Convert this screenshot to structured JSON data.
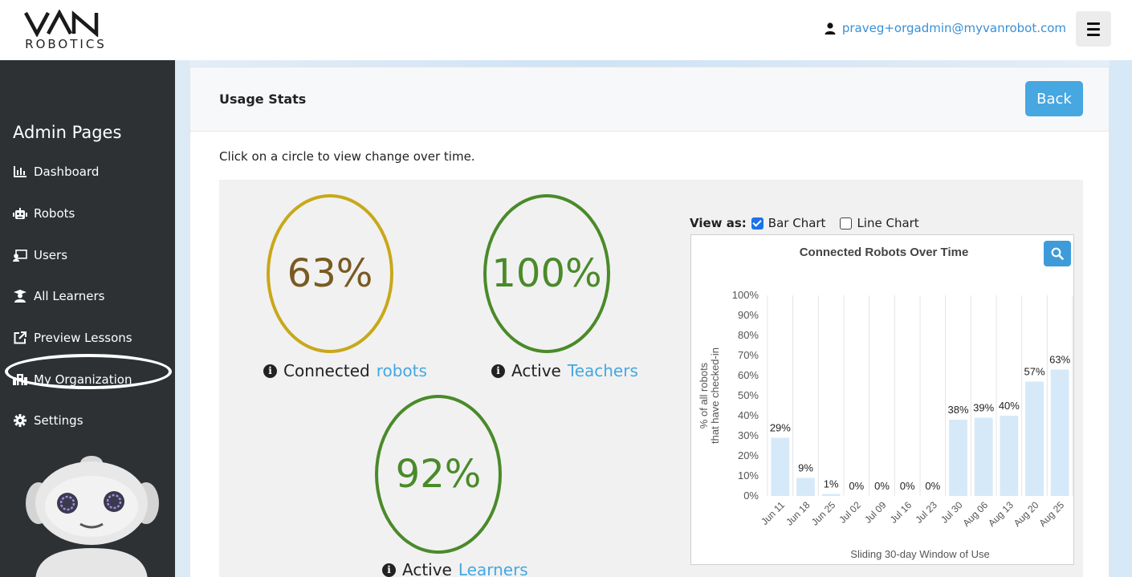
{
  "header": {
    "logo_text": "ROBOTICS",
    "user_email": "praveg+orgadmin@myvanrobot.com"
  },
  "sidebar": {
    "title": "Admin Pages",
    "items": [
      {
        "label": "Dashboard",
        "icon": "chart-icon"
      },
      {
        "label": "Robots",
        "icon": "robot-icon"
      },
      {
        "label": "Users",
        "icon": "users-icon"
      },
      {
        "label": "All Learners",
        "icon": "learner-icon"
      },
      {
        "label": "Preview Lessons",
        "icon": "external-link-icon"
      },
      {
        "label": "My Organization",
        "icon": "organization-icon"
      },
      {
        "label": "Settings",
        "icon": "gear-icon"
      }
    ]
  },
  "card": {
    "title": "Usage Stats",
    "back_label": "Back",
    "instruction": "Click on a circle to view change over time."
  },
  "stats": [
    {
      "value": "63%",
      "label_prefix": "Connected",
      "label_link": "robots",
      "color": "#c8a81a",
      "text_color": "#7a5a22"
    },
    {
      "value": "100%",
      "label_prefix": "Active",
      "label_link": "Teachers",
      "color": "#4a8a2a",
      "text_color": "#4a8a2a"
    },
    {
      "value": "92%",
      "label_prefix": "Active",
      "label_link": "Learners",
      "color": "#4a8a2a",
      "text_color": "#4a8a2a"
    }
  ],
  "view_as": {
    "label": "View as:",
    "bar_label": "Bar Chart",
    "line_label": "Line Chart",
    "bar_checked": true,
    "line_checked": false
  },
  "chart_data": {
    "type": "bar",
    "title": "Connected Robots Over Time",
    "xlabel": "Sliding 30-day Window of Use",
    "ylabel_line1": "% of all robots",
    "ylabel_line2": "that have checked-in",
    "categories": [
      "Jun 11",
      "Jun 18",
      "Jun 25",
      "Jul 02",
      "Jul 09",
      "Jul 16",
      "Jul 23",
      "Jul 30",
      "Aug 06",
      "Aug 13",
      "Aug 20",
      "Aug 25"
    ],
    "values": [
      29,
      9,
      1,
      0,
      0,
      0,
      0,
      38,
      39,
      40,
      57,
      63
    ],
    "ylim": [
      0,
      100
    ],
    "yticks": [
      "0%",
      "10%",
      "20%",
      "30%",
      "40%",
      "50%",
      "60%",
      "70%",
      "80%",
      "90%",
      "100%"
    ],
    "bar_color": "#d6e9f8",
    "grid": true
  },
  "colors": {
    "accent": "#46a7e1",
    "sidebar_bg": "#2d3134"
  }
}
